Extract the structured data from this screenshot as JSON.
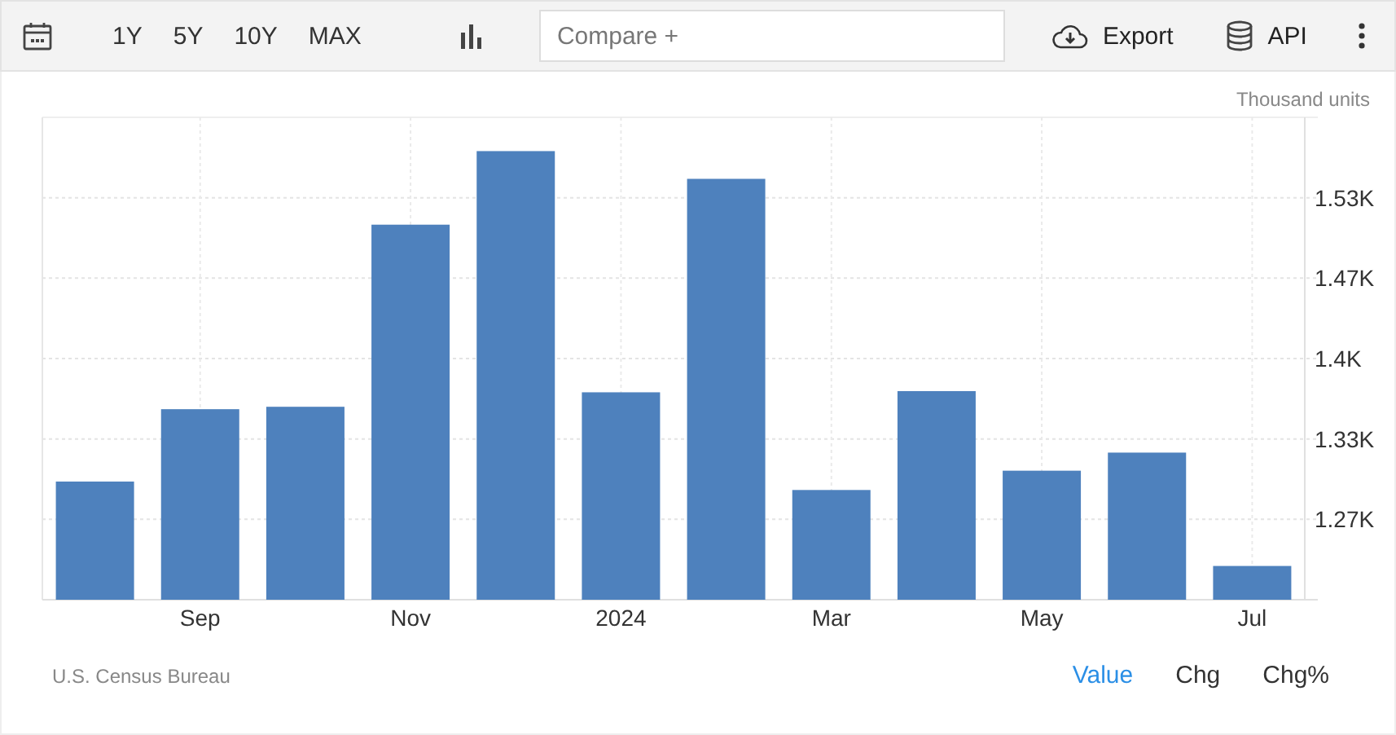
{
  "toolbar": {
    "ranges": [
      "1Y",
      "5Y",
      "10Y",
      "MAX"
    ],
    "compare": {
      "placeholder": "Compare +"
    },
    "export": "Export",
    "api": "API"
  },
  "chart": {
    "unit": "Thousand units",
    "chart_data": {
      "type": "bar",
      "categories": [
        null,
        "Sep",
        null,
        "Nov",
        null,
        "2024",
        null,
        "Mar",
        null,
        "May",
        null,
        "Jul"
      ],
      "values": [
        1.298,
        1.358,
        1.36,
        1.511,
        1.572,
        1.372,
        1.549,
        1.291,
        1.373,
        1.307,
        1.322,
        1.228
      ],
      "ylim": [
        1.2,
        1.6
      ],
      "grid": true,
      "yticks": [
        {
          "value": 1.2667,
          "label": "1.27K"
        },
        {
          "value": 1.3333,
          "label": "1.33K"
        },
        {
          "value": 1.4,
          "label": "1.4K"
        },
        {
          "value": 1.4667,
          "label": "1.47K"
        },
        {
          "value": 1.5333,
          "label": "1.53K"
        }
      ]
    }
  },
  "footer": {
    "source": "U.S. Census Bureau",
    "modes": [
      {
        "label": "Value",
        "selected": true
      },
      {
        "label": "Chg",
        "selected": false
      },
      {
        "label": "Chg%",
        "selected": false
      }
    ]
  }
}
